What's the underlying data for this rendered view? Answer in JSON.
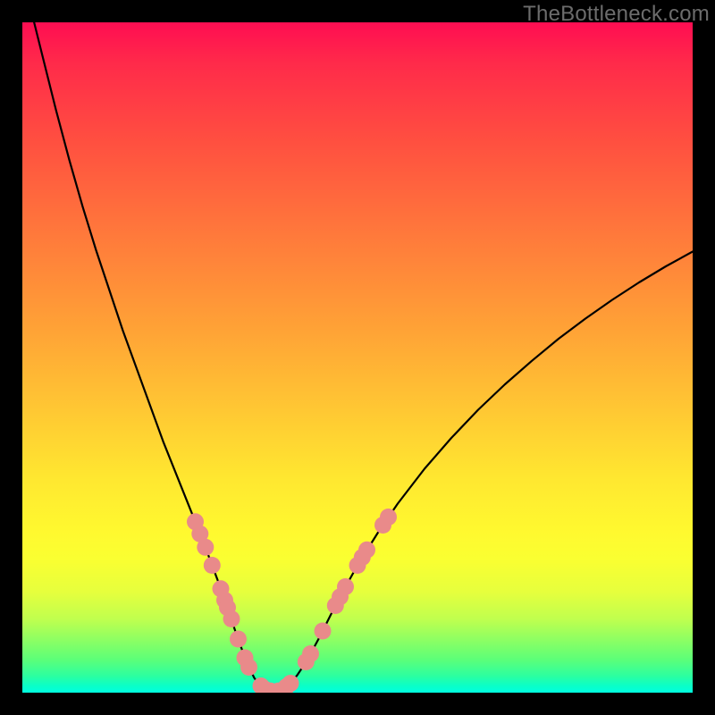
{
  "watermark": "TheBottleneck.com",
  "colors": {
    "curve_stroke": "#000000",
    "marker_fill": "#e98a8a",
    "marker_stroke": "#d77575",
    "frame": "#000000"
  },
  "chart_data": {
    "type": "line",
    "title": "",
    "xlabel": "",
    "ylabel": "",
    "xlim": [
      0,
      100
    ],
    "ylim": [
      0,
      100
    ],
    "grid": false,
    "curve": [
      {
        "x": 1.5,
        "y": 101.0
      },
      {
        "x": 3.0,
        "y": 95.0
      },
      {
        "x": 5.0,
        "y": 87.0
      },
      {
        "x": 7.0,
        "y": 79.5
      },
      {
        "x": 9.0,
        "y": 72.5
      },
      {
        "x": 11.0,
        "y": 66.0
      },
      {
        "x": 13.0,
        "y": 60.0
      },
      {
        "x": 15.0,
        "y": 54.0
      },
      {
        "x": 17.0,
        "y": 48.5
      },
      {
        "x": 19.0,
        "y": 43.0
      },
      {
        "x": 21.0,
        "y": 37.5
      },
      {
        "x": 23.0,
        "y": 32.5
      },
      {
        "x": 25.0,
        "y": 27.5
      },
      {
        "x": 27.0,
        "y": 22.5
      },
      {
        "x": 28.5,
        "y": 18.5
      },
      {
        "x": 30.0,
        "y": 14.5
      },
      {
        "x": 31.0,
        "y": 11.5
      },
      {
        "x": 32.0,
        "y": 8.5
      },
      {
        "x": 33.0,
        "y": 5.8
      },
      {
        "x": 33.8,
        "y": 3.8
      },
      {
        "x": 34.6,
        "y": 2.2
      },
      {
        "x": 35.4,
        "y": 1.1
      },
      {
        "x": 36.2,
        "y": 0.5
      },
      {
        "x": 37.0,
        "y": 0.2
      },
      {
        "x": 38.0,
        "y": 0.2
      },
      {
        "x": 39.0,
        "y": 0.6
      },
      {
        "x": 40.0,
        "y": 1.4
      },
      {
        "x": 41.0,
        "y": 2.6
      },
      {
        "x": 42.0,
        "y": 4.1
      },
      {
        "x": 43.0,
        "y": 5.8
      },
      {
        "x": 44.5,
        "y": 8.6
      },
      {
        "x": 46.0,
        "y": 11.6
      },
      {
        "x": 48.0,
        "y": 15.4
      },
      {
        "x": 50.0,
        "y": 19.0
      },
      {
        "x": 53.0,
        "y": 23.8
      },
      {
        "x": 56.0,
        "y": 28.2
      },
      {
        "x": 60.0,
        "y": 33.4
      },
      {
        "x": 64.0,
        "y": 38.0
      },
      {
        "x": 68.0,
        "y": 42.2
      },
      {
        "x": 72.0,
        "y": 46.0
      },
      {
        "x": 76.0,
        "y": 49.5
      },
      {
        "x": 80.0,
        "y": 52.8
      },
      {
        "x": 84.0,
        "y": 55.8
      },
      {
        "x": 88.0,
        "y": 58.6
      },
      {
        "x": 92.0,
        "y": 61.2
      },
      {
        "x": 96.0,
        "y": 63.6
      },
      {
        "x": 100.0,
        "y": 65.8
      }
    ],
    "markers_left": [
      {
        "x": 25.8,
        "y": 25.5
      },
      {
        "x": 26.5,
        "y": 23.7
      },
      {
        "x": 27.3,
        "y": 21.7
      },
      {
        "x": 28.3,
        "y": 19.0
      },
      {
        "x": 29.6,
        "y": 15.5
      },
      {
        "x": 30.2,
        "y": 13.8
      },
      {
        "x": 30.6,
        "y": 12.7
      },
      {
        "x": 31.2,
        "y": 11.0
      },
      {
        "x": 32.2,
        "y": 8.0
      },
      {
        "x": 33.2,
        "y": 5.2
      },
      {
        "x": 33.8,
        "y": 3.8
      },
      {
        "x": 35.6,
        "y": 1.0
      },
      {
        "x": 36.2,
        "y": 0.5
      },
      {
        "x": 37.0,
        "y": 0.25
      },
      {
        "x": 38.2,
        "y": 0.25
      },
      {
        "x": 39.4,
        "y": 0.9
      },
      {
        "x": 40.0,
        "y": 1.4
      }
    ],
    "markers_right": [
      {
        "x": 42.3,
        "y": 4.6
      },
      {
        "x": 43.0,
        "y": 5.8
      },
      {
        "x": 44.8,
        "y": 9.2
      },
      {
        "x": 46.7,
        "y": 13.0
      },
      {
        "x": 47.4,
        "y": 14.3
      },
      {
        "x": 48.2,
        "y": 15.8
      },
      {
        "x": 50.0,
        "y": 19.0
      },
      {
        "x": 50.7,
        "y": 20.2
      },
      {
        "x": 51.4,
        "y": 21.3
      },
      {
        "x": 53.8,
        "y": 25.0
      },
      {
        "x": 54.6,
        "y": 26.2
      }
    ]
  }
}
